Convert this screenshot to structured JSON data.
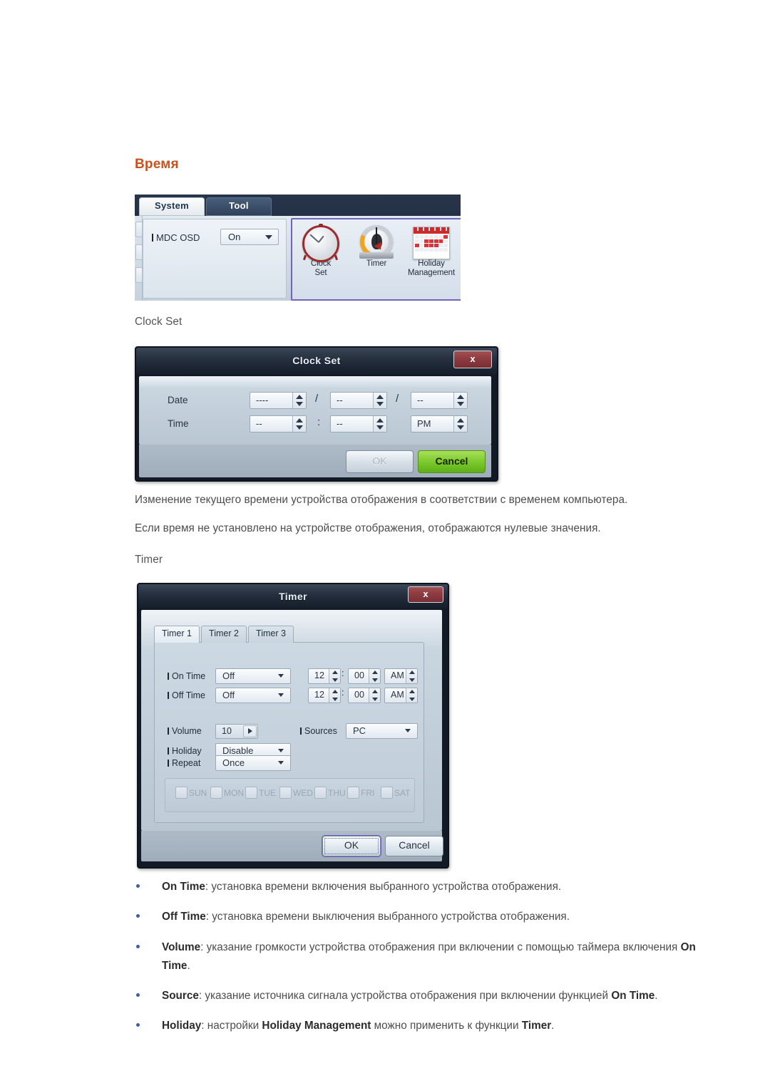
{
  "page": {
    "title": "Время"
  },
  "mdc_panel": {
    "tabs": [
      {
        "label": "System",
        "active": true
      },
      {
        "label": "Tool",
        "active": false
      }
    ],
    "osd": {
      "label": "MDC OSD",
      "value": "On"
    },
    "icons": [
      {
        "name": "clock-set-icon",
        "line1": "Clock",
        "line2": "Set"
      },
      {
        "name": "timer-icon",
        "line1": "Timer",
        "line2": ""
      },
      {
        "name": "holiday-management-icon",
        "line1": "Holiday",
        "line2": "Management"
      }
    ],
    "highlight_color": "#7264bd"
  },
  "clock_set": {
    "caption": "Clock Set",
    "dialog": {
      "title": "Clock Set",
      "close_label": "x",
      "rows": [
        {
          "label": "Date",
          "fields": [
            "----",
            "--",
            "--"
          ],
          "separators": [
            "/",
            "/"
          ]
        },
        {
          "label": "Time",
          "fields": [
            "--",
            "--",
            "PM"
          ],
          "separators": [
            ":",
            ""
          ]
        }
      ],
      "buttons": {
        "ok": "OK",
        "cancel": "Cancel"
      }
    },
    "paragraphs": [
      "Изменение текущего времени устройства отображения в соответствии с временем компьютера.",
      "Если время не установлено на устройстве отображения, отображаются нулевые значения."
    ]
  },
  "timer": {
    "caption": "Timer",
    "dialog": {
      "title": "Timer",
      "close_label": "x",
      "tabs": [
        {
          "label": "Timer 1",
          "active": true
        },
        {
          "label": "Timer 2",
          "active": false
        },
        {
          "label": "Timer 3",
          "active": false
        }
      ],
      "on_time": {
        "label": "On Time",
        "state": "Off",
        "hour": "12",
        "minute": "00",
        "meridiem": "AM"
      },
      "off_time": {
        "label": "Off Time",
        "state": "Off",
        "hour": "12",
        "minute": "00",
        "meridiem": "AM"
      },
      "volume": {
        "label": "Volume",
        "value": "10"
      },
      "sources": {
        "label": "Sources",
        "value": "PC"
      },
      "holiday": {
        "label": "Holiday",
        "value": "Disable"
      },
      "repeat": {
        "label": "Repeat",
        "value": "Once"
      },
      "time_separator": ":",
      "days": [
        {
          "label": "SUN",
          "checked": false
        },
        {
          "label": "MON",
          "checked": false
        },
        {
          "label": "TUE",
          "checked": false
        },
        {
          "label": "WED",
          "checked": false
        },
        {
          "label": "THU",
          "checked": false
        },
        {
          "label": "FRI",
          "checked": false
        },
        {
          "label": "SAT",
          "checked": false
        }
      ],
      "buttons": {
        "ok": "OK",
        "cancel": "Cancel"
      }
    }
  },
  "bullets": [
    {
      "term": "On Time",
      "rest": ": установка времени включения выбранного устройства отображения."
    },
    {
      "term": "Off Time",
      "rest": ": установка времени выключения выбранного устройства отображения."
    },
    {
      "term": "Volume",
      "rest": ": указание громкости устройства отображения при включении с помощью таймера включения ",
      "term2": "On Time",
      "rest2": "."
    },
    {
      "term": "Source",
      "rest": ": указание источника сигнала устройства отображения при включении функцией ",
      "term2": "On Time",
      "rest2": "."
    },
    {
      "term": "Holiday",
      "rest": ": настройки ",
      "term2": "Holiday Management",
      "rest2": " можно применить к функции ",
      "term3": "Timer",
      "rest3": "."
    }
  ]
}
